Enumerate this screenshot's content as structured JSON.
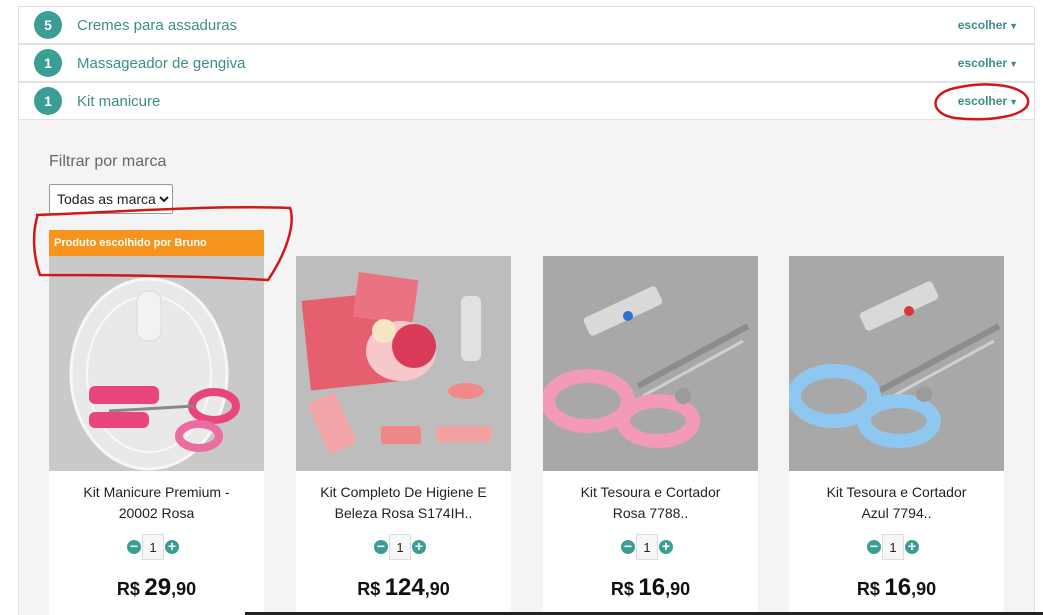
{
  "categories": [
    {
      "count": "5",
      "label": "Cremes para assaduras",
      "action": "escolher"
    },
    {
      "count": "1",
      "label": "Massageador de gengiva",
      "action": "escolher"
    },
    {
      "count": "1",
      "label": "Kit manicure",
      "action": "escolher"
    }
  ],
  "filter": {
    "title": "Filtrar por marca",
    "selected": "Todas as marcas"
  },
  "ribbon": "Produto escolhido por Bruno",
  "products": [
    {
      "name_line1": "Kit Manicure Premium -",
      "name_line2": "20002 Rosa",
      "qty": "1",
      "currency": "R$",
      "price_int": "29",
      "price_dec": ",90"
    },
    {
      "name_line1": "Kit Completo De Higiene E",
      "name_line2": "Beleza Rosa  S174IH..",
      "qty": "1",
      "currency": "R$",
      "price_int": "124",
      "price_dec": ",90"
    },
    {
      "name_line1": "Kit Tesoura e Cortador",
      "name_line2": "Rosa 7788..",
      "qty": "1",
      "currency": "R$",
      "price_int": "16",
      "price_dec": ",90"
    },
    {
      "name_line1": "Kit Tesoura e Cortador",
      "name_line2": "Azul 7794..",
      "qty": "1",
      "currency": "R$",
      "price_int": "16",
      "price_dec": ",90"
    }
  ],
  "colors": {
    "accent": "#3a9e94",
    "ribbon": "#f7941d",
    "annotation": "#d01818"
  }
}
